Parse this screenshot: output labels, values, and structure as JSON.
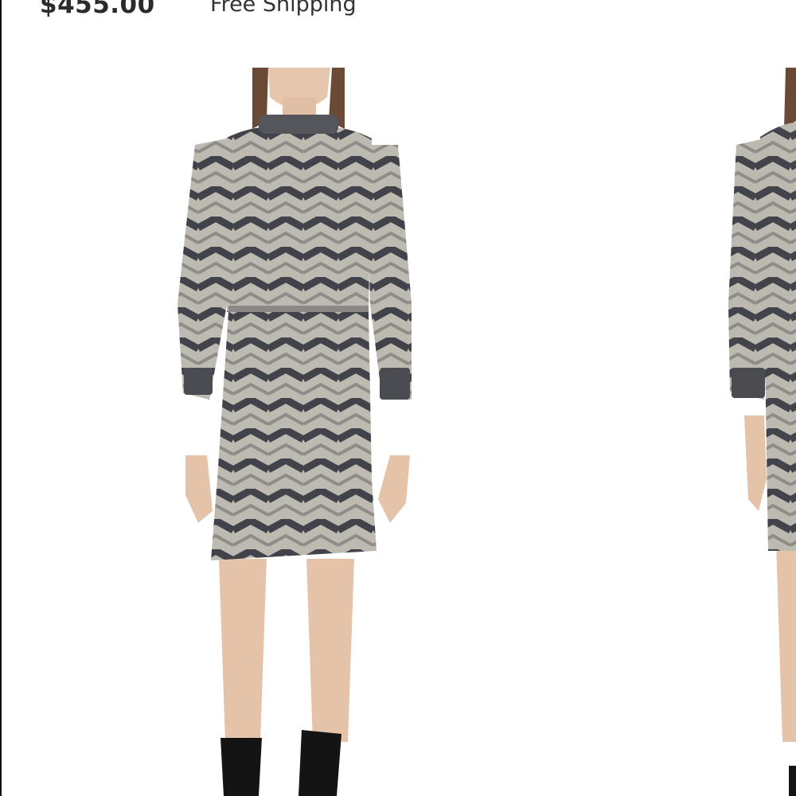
{
  "product": {
    "price": "$455.00",
    "shipping": "Free Shipping"
  },
  "gallery": {
    "image_count_visible": 2,
    "colors": {
      "fabric_light": "#b9b6ae",
      "fabric_dark": "#3f4048",
      "skin": "#e6c7ae",
      "hair": "#6b4a35",
      "boots": "#141414"
    }
  }
}
